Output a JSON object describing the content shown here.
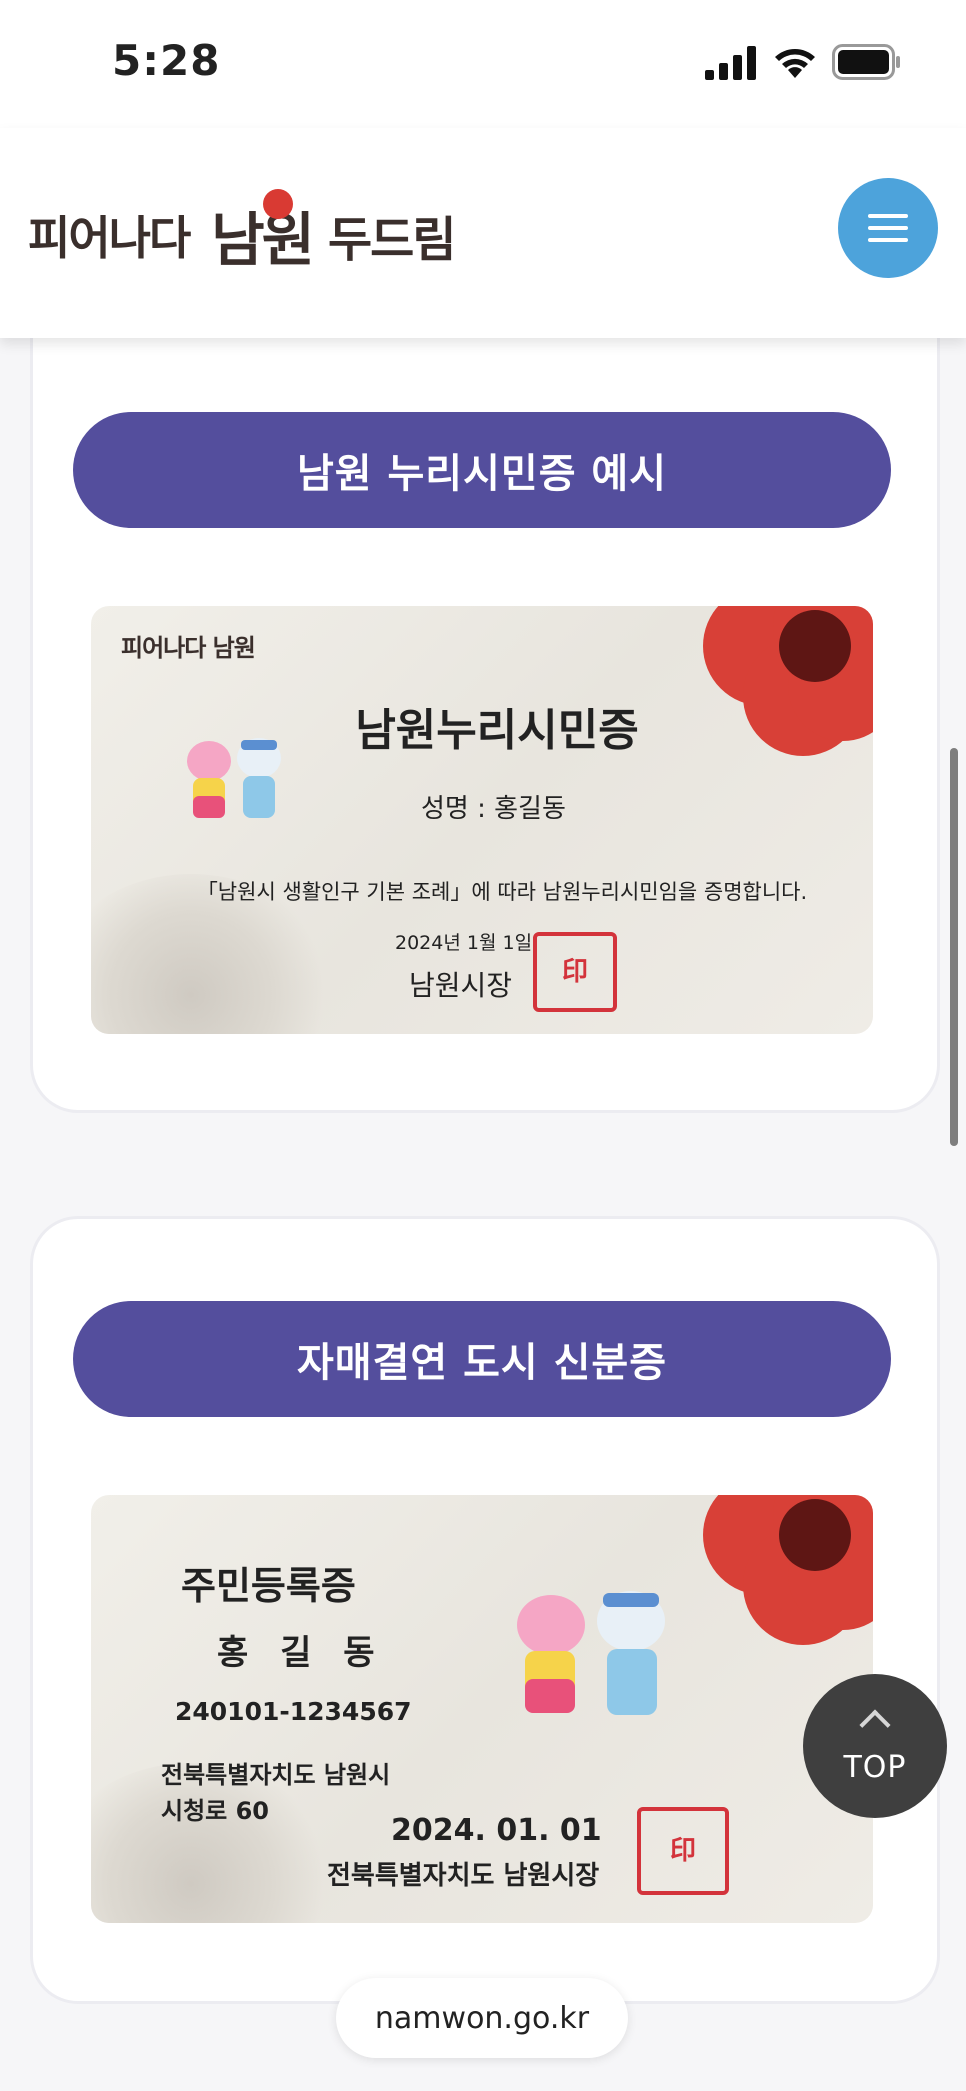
{
  "status_bar": {
    "time": "5:28"
  },
  "header": {
    "logo_part1": "피어나다",
    "logo_part2": "남원",
    "logo_part3": "두드림",
    "menu_icon": "hamburger-menu-icon"
  },
  "section1": {
    "heading": "남원 누리시민증 예시",
    "card": {
      "mini_logo": "피어나다 남원",
      "title": "남원누리시민증",
      "name_line": "성명 : 홍길동",
      "description": "「남원시 생활인구 기본 조례」에 따라 남원누리시민임을 증명합니다.",
      "date": "2024년 1월 1일",
      "issuer": "남원시장",
      "seal_text": "남원시장인"
    }
  },
  "section2": {
    "heading": "자매결연 도시 신분증",
    "card": {
      "title": "주민등록증",
      "name": "홍 길 동",
      "number": "240101-1234567",
      "address_line1": "전북특별자치도 남원시",
      "address_line2": "시청로 60",
      "date": "2024. 01. 01",
      "issuer": "전북특별자치도 남원시장",
      "seal_text": "남원시장인"
    }
  },
  "top_button": {
    "label": "TOP"
  },
  "browser": {
    "url": "namwon.go.kr"
  },
  "colors": {
    "accent": "#544e9d",
    "menu": "#4da3db",
    "flower": "#d84037",
    "seal": "#d3333b"
  }
}
